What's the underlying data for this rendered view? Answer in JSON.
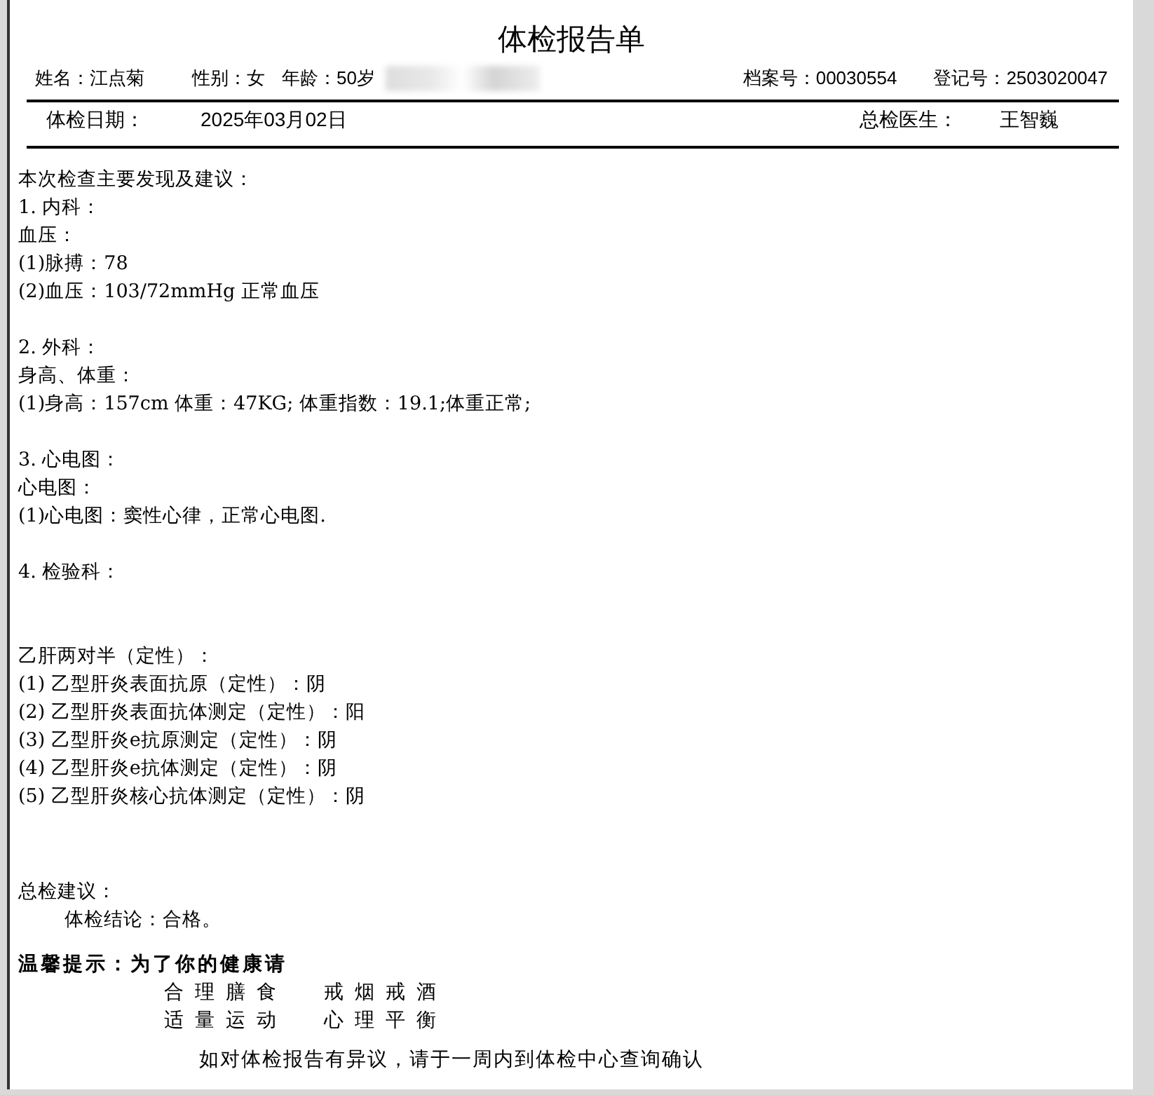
{
  "title": "体检报告单",
  "patient": {
    "name": "姓名：江点菊",
    "sex": "性别：女",
    "age": "年龄：50岁",
    "file_no": "档案号：00030554",
    "reg_no": "登记号：2503020047"
  },
  "exam": {
    "date_label": "体检日期：",
    "date": "2025年03月02日",
    "doctor_label": "总检医生：",
    "doctor": "王智巍"
  },
  "findings_heading": "本次检查主要发现及建议：",
  "groups": [
    {
      "title": "1.  内科：",
      "lines": [
        "血压：",
        "(1)脉搏：78",
        "(2)血压：103/72mmHg 正常血压"
      ]
    },
    {
      "title": "2.  外科：",
      "lines": [
        "身高、体重：",
        "(1)身高：157cm 体重：47KG; 体重指数：19.1;体重正常;"
      ]
    },
    {
      "title": "3.  心电图：",
      "lines": [
        "心电图：",
        "(1)心电图：窦性心律，正常心电图."
      ]
    },
    {
      "title": "4.  检验科："
    },
    {
      "title": "乙肝两对半（定性）：",
      "lines": [
        "(1)  乙型肝炎表面抗原（定性）：阴",
        "(2)  乙型肝炎表面抗体测定（定性）：阳",
        "(3)  乙型肝炎e抗原测定（定性）：阴",
        "(4)  乙型肝炎e抗体测定（定性）：阴",
        "(5)  乙型肝炎核心抗体测定（定性）：阴"
      ]
    }
  ],
  "advice": {
    "heading": "总检建议：",
    "conclusion": "体检结论：合格。"
  },
  "tips": {
    "heading": "温馨提示：为了你的健康请",
    "rows": [
      [
        "合理膳食",
        "戒烟戒酒"
      ],
      [
        "适量运动",
        "心理平衡"
      ]
    ]
  },
  "footer_note": "如对体检报告有异议，请于一周内到体检中心查询确认"
}
